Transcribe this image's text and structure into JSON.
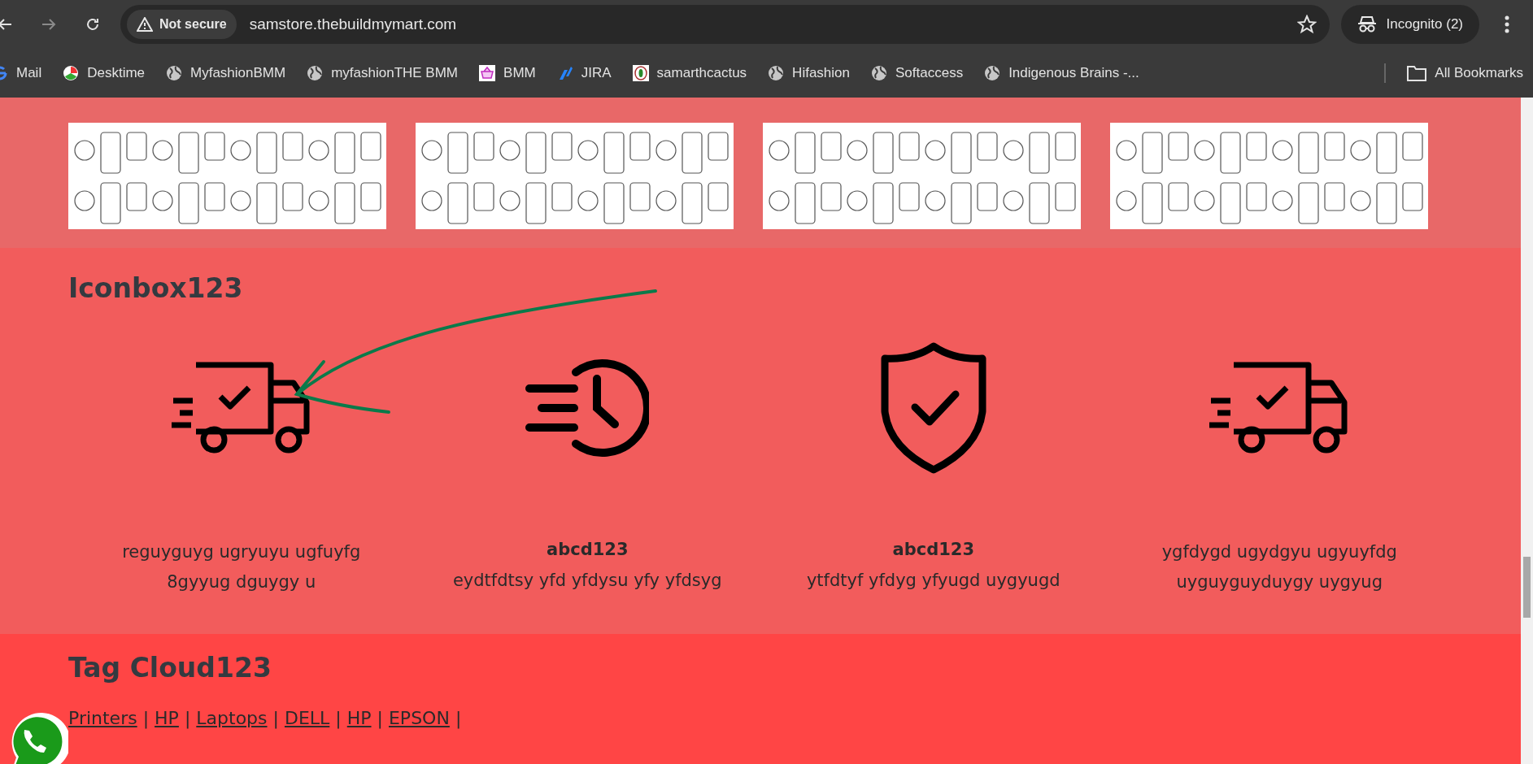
{
  "browser": {
    "security_label": "Not secure",
    "url": "samstore.thebuildmymart.com",
    "profile": "Incognito (2)",
    "bookmarks": [
      "Mail",
      "Desktime",
      "MyfashionBMM",
      "myfashionTHE BMM",
      "BMM",
      "JIRA",
      "samarthcactus",
      "Hifashion",
      "Softaccess",
      "Indigenous Brains -..."
    ],
    "all_bookmarks": "All Bookmarks"
  },
  "iconbox": {
    "title": "Iconbox123",
    "items": [
      {
        "description": "reguyguyg ugryuyu ugfuyfg 8gyyug dguygy u"
      },
      {
        "title": "abcd123",
        "description": "eydtfdtsy yfd yfdysu yfy yfdsyg"
      },
      {
        "title": "abcd123",
        "description": "ytfdtyf yfdyg yfyugd uygyugd"
      },
      {
        "description": "ygfdygd ugydgyu ugyuyfdg uyguyguyduygy uygyug"
      }
    ]
  },
  "tag_cloud": {
    "title": "Tag Cloud123",
    "tags": [
      "Printers",
      "HP",
      "Laptops",
      "DELL",
      "HP",
      "EPSON"
    ],
    "separator": "|"
  }
}
